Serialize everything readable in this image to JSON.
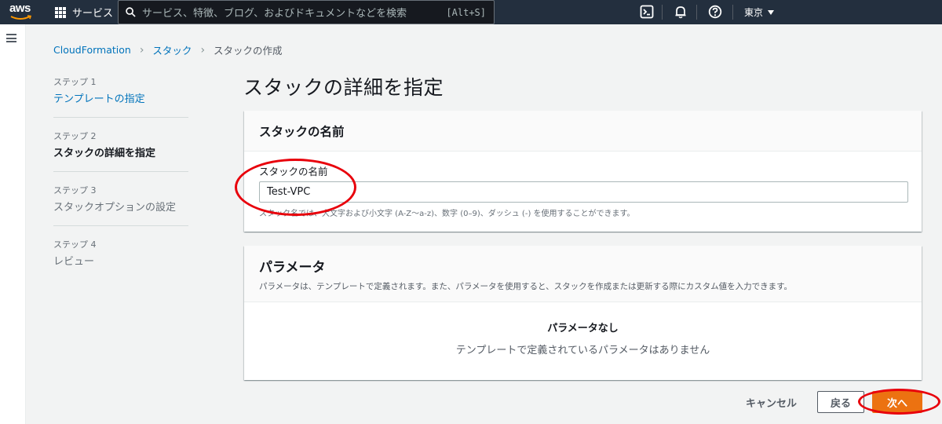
{
  "topnav": {
    "logo": "aws",
    "services_label": "サービス",
    "search_placeholder": "サービス、特徴、ブログ、およびドキュメントなどを検索",
    "search_shortcut": "[Alt+S]",
    "region": "東京",
    "icons": [
      "cloudshell-icon",
      "bell-icon",
      "help-icon"
    ]
  },
  "breadcrumb": {
    "items": [
      "CloudFormation",
      "スタック",
      "スタックの作成"
    ]
  },
  "steps": [
    {
      "num": "ステップ 1",
      "label": "テンプレートの指定",
      "state": "link"
    },
    {
      "num": "ステップ 2",
      "label": "スタックの詳細を指定",
      "state": "active"
    },
    {
      "num": "ステップ 3",
      "label": "スタックオプションの設定",
      "state": "disabled"
    },
    {
      "num": "ステップ 4",
      "label": "レビュー",
      "state": "disabled"
    }
  ],
  "page_title": "スタックの詳細を指定",
  "stack_name_panel": {
    "title": "スタックの名前",
    "field_label": "スタックの名前",
    "value": "Test-VPC",
    "hint": "スタック名では、大文字および小文字 (A-Z〜a-z)、数字 (0–9)、ダッシュ (-) を使用することができます。"
  },
  "parameters_panel": {
    "title": "パラメータ",
    "description": "パラメータは、テンプレートで定義されます。また、パラメータを使用すると、スタックを作成または更新する際にカスタム値を入力できます。",
    "empty_title": "パラメータなし",
    "empty_sub": "テンプレートで定義されているパラメータはありません"
  },
  "footer": {
    "cancel": "キャンセル",
    "back": "戻る",
    "next": "次へ"
  },
  "colors": {
    "nav_bg": "#232f3e",
    "link": "#0073bb",
    "primary": "#ec7211",
    "annotation": "#e8000b"
  }
}
